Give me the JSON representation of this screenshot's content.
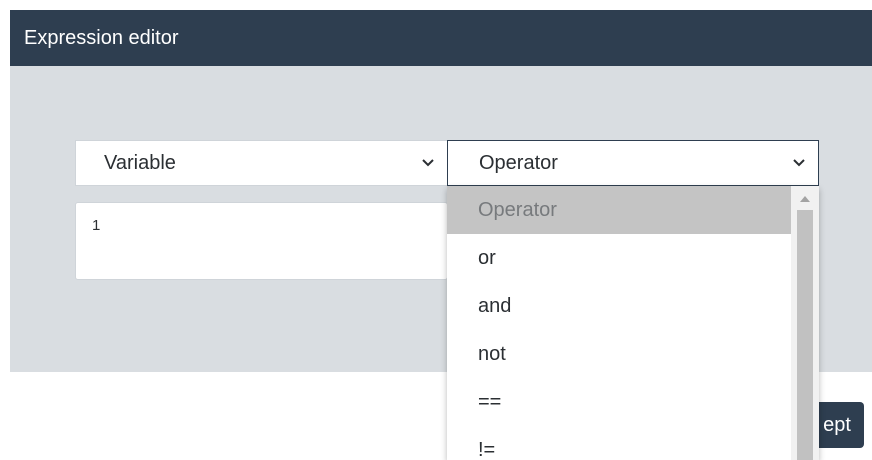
{
  "dialog": {
    "title": "Expression editor"
  },
  "variable_select": {
    "selected": "Variable",
    "icon": "chevron-down-icon"
  },
  "operator_select": {
    "selected": "Operator",
    "icon": "chevron-down-icon",
    "options": [
      "Operator",
      "or",
      "and",
      "not",
      "==",
      "!="
    ],
    "highlighted_option": "Operator"
  },
  "expression": {
    "value": "1"
  },
  "footer": {
    "accept_label_visible": "ept"
  },
  "colors": {
    "header_bg": "#2e3e50",
    "body_bg": "#d9dde1",
    "option_highlight": "#c4c4c4"
  }
}
